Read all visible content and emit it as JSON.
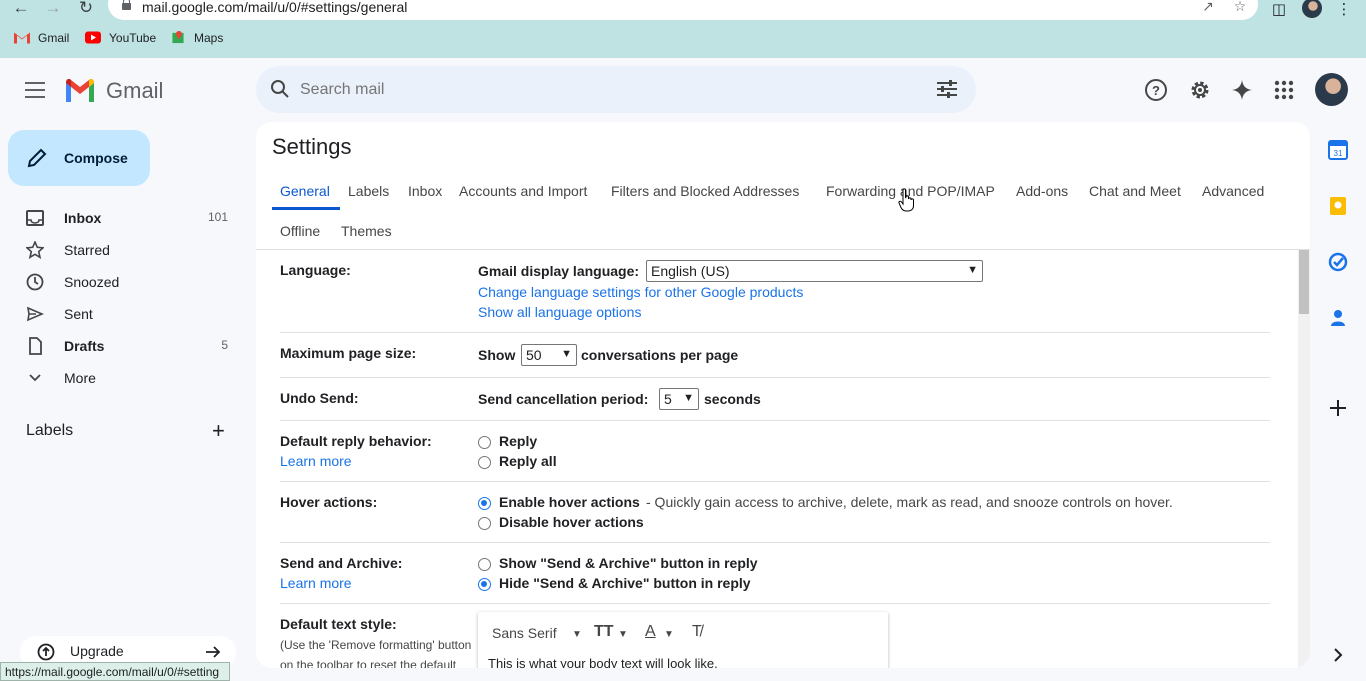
{
  "browser": {
    "url": "mail.google.com/mail/u/0/#settings/general",
    "bookmarks": [
      "Gmail",
      "YouTube",
      "Maps"
    ],
    "status_url": "https://mail.google.com/mail/u/0/#setting"
  },
  "header": {
    "app_name": "Gmail",
    "search_placeholder": "Search mail"
  },
  "sidebar": {
    "compose_label": "Compose",
    "items": [
      {
        "label": "Inbox",
        "count": "101",
        "icon": "inbox-icon"
      },
      {
        "label": "Starred",
        "count": "",
        "icon": "star-icon"
      },
      {
        "label": "Snoozed",
        "count": "",
        "icon": "clock-icon"
      },
      {
        "label": "Sent",
        "count": "",
        "icon": "send-icon"
      },
      {
        "label": "Drafts",
        "count": "5",
        "icon": "draft-icon"
      },
      {
        "label": "More",
        "count": "",
        "icon": "chevron-down-icon"
      }
    ],
    "labels_heading": "Labels",
    "upgrade_label": "Upgrade"
  },
  "settings": {
    "title": "Settings",
    "tabs": [
      "General",
      "Labels",
      "Inbox",
      "Accounts and Import",
      "Filters and Blocked Addresses",
      "Forwarding and POP/IMAP",
      "Add-ons",
      "Chat and Meet",
      "Advanced",
      "Offline",
      "Themes"
    ],
    "active_tab": "General",
    "language": {
      "label": "Language:",
      "display_label": "Gmail display language:",
      "selected": "English (US)",
      "link1": "Change language settings for other Google products",
      "link2": "Show all language options"
    },
    "page_size": {
      "label": "Maximum page size:",
      "prefix": "Show",
      "selected": "50",
      "suffix": "conversations per page"
    },
    "undo_send": {
      "label": "Undo Send:",
      "prefix": "Send cancellation period:",
      "selected": "5",
      "suffix": "seconds"
    },
    "reply": {
      "label": "Default reply behavior:",
      "learn_more": "Learn more",
      "options": [
        "Reply",
        "Reply all"
      ]
    },
    "hover": {
      "label": "Hover actions:",
      "option1": "Enable hover actions",
      "option1_desc": " - Quickly gain access to archive, delete, mark as read, and snooze controls on hover.",
      "option2": "Disable hover actions"
    },
    "send_archive": {
      "label": "Send and Archive:",
      "learn_more": "Learn more",
      "option1": "Show \"Send & Archive\" button in reply",
      "option2": "Hide \"Send & Archive\" button in reply"
    },
    "text_style": {
      "label": "Default text style:",
      "hint1": "(Use the 'Remove formatting' button",
      "hint2": "on the toolbar to reset the default",
      "font": "Sans Serif",
      "preview": "This is what your body text will look like."
    }
  },
  "colors": {
    "accent": "#0b57d0",
    "compose_bg": "#c2e7ff",
    "link": "#1a73e8",
    "browser_bar": "#bfe3e3"
  }
}
